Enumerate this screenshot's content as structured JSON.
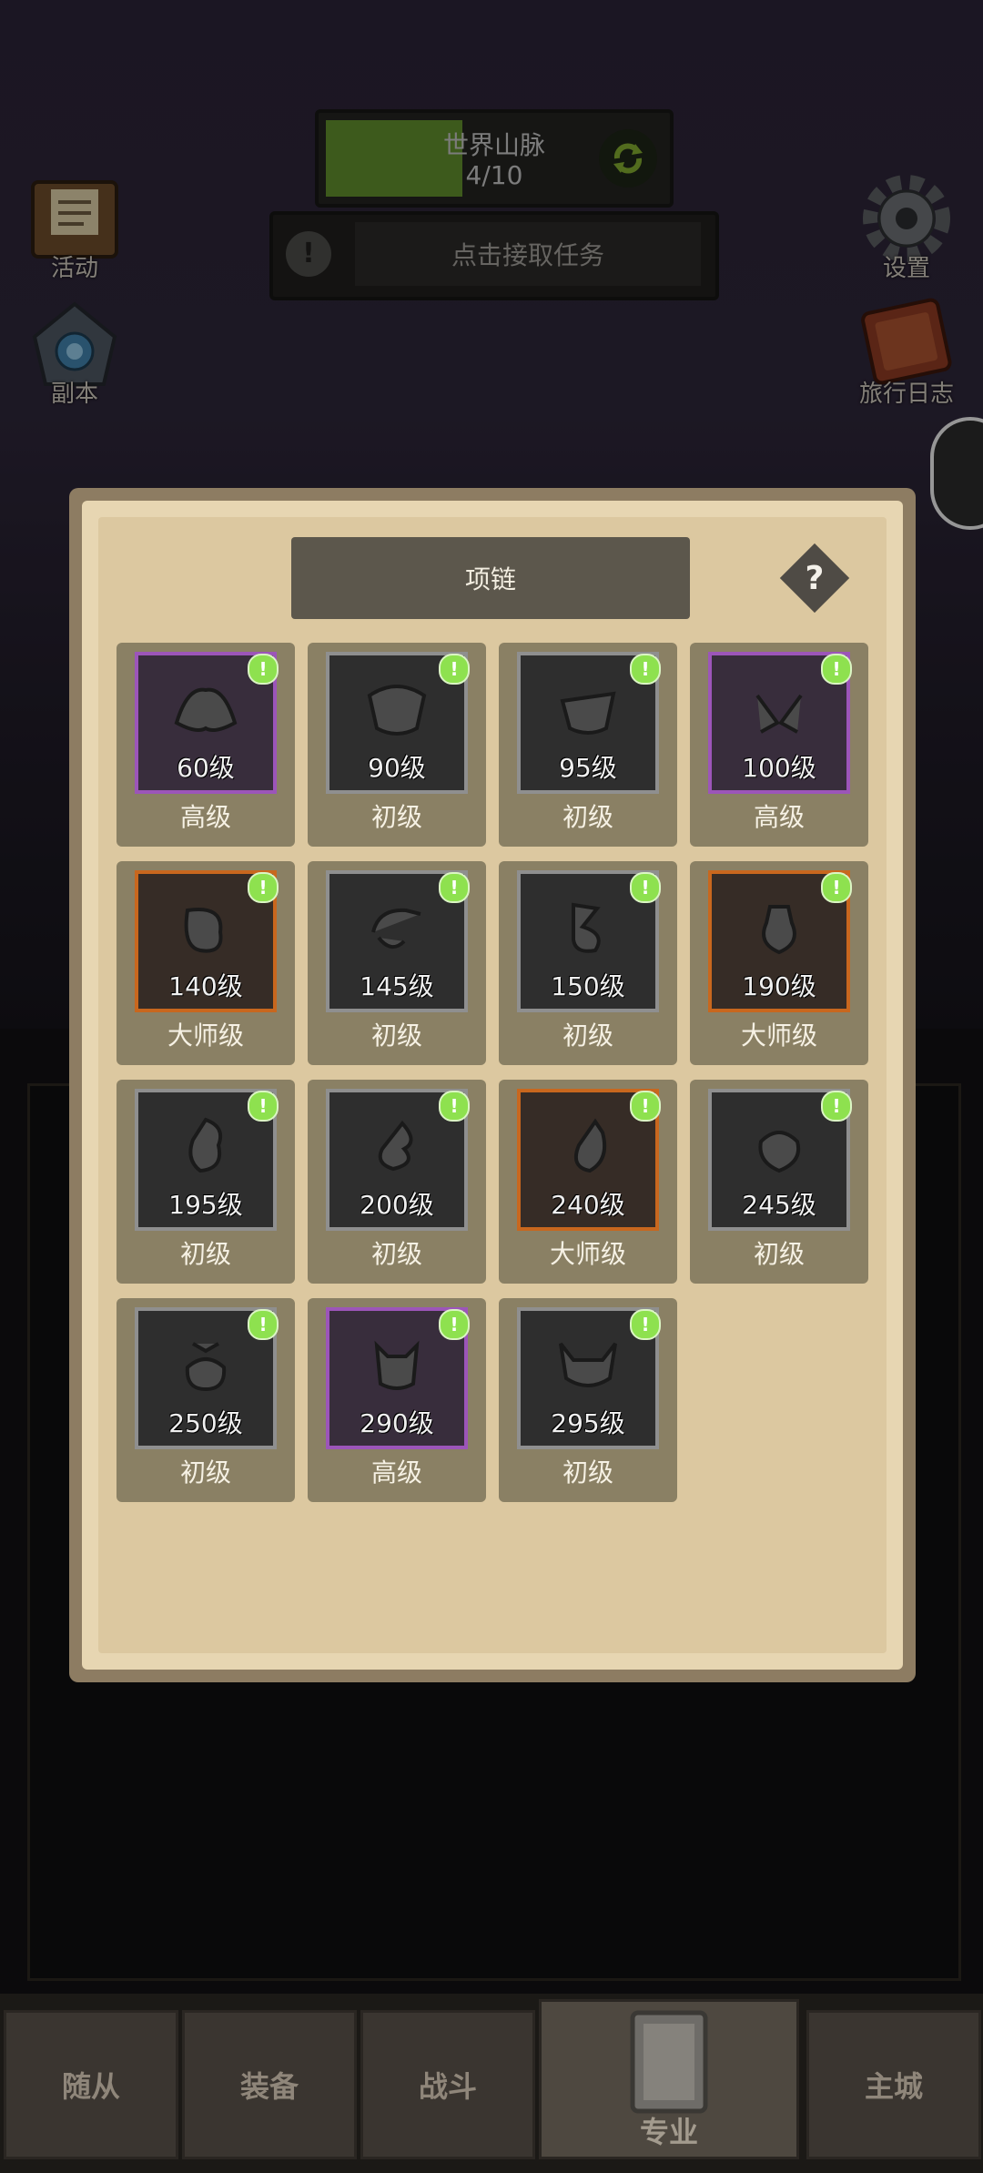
{
  "hud": {
    "map_title": "世界山脉",
    "map_progress": "4/10",
    "map_progress_fraction": 0.4,
    "quest_text": "点击接取任务"
  },
  "side_left": [
    {
      "label": "活动",
      "icon": "activity-board-icon"
    },
    {
      "label": "副本",
      "icon": "dungeon-portal-icon"
    }
  ],
  "side_right": [
    {
      "label": "设置",
      "icon": "gear-icon"
    },
    {
      "label": "旅行日志",
      "icon": "journal-book-icon"
    }
  ],
  "panel": {
    "title": "项链",
    "help_label": "?",
    "badge_symbol": "!",
    "items": [
      {
        "level": "60级",
        "grade": "高级",
        "quality": "senior"
      },
      {
        "level": "90级",
        "grade": "初级",
        "quality": "basic"
      },
      {
        "level": "95级",
        "grade": "初级",
        "quality": "basic"
      },
      {
        "level": "100级",
        "grade": "高级",
        "quality": "senior"
      },
      {
        "level": "140级",
        "grade": "大师级",
        "quality": "master"
      },
      {
        "level": "145级",
        "grade": "初级",
        "quality": "basic"
      },
      {
        "level": "150级",
        "grade": "初级",
        "quality": "basic"
      },
      {
        "level": "190级",
        "grade": "大师级",
        "quality": "master"
      },
      {
        "level": "195级",
        "grade": "初级",
        "quality": "basic"
      },
      {
        "level": "200级",
        "grade": "初级",
        "quality": "basic"
      },
      {
        "level": "240级",
        "grade": "大师级",
        "quality": "master"
      },
      {
        "level": "245级",
        "grade": "初级",
        "quality": "basic"
      },
      {
        "level": "250级",
        "grade": "初级",
        "quality": "basic"
      },
      {
        "level": "290级",
        "grade": "高级",
        "quality": "senior"
      },
      {
        "level": "295级",
        "grade": "初级",
        "quality": "basic"
      }
    ]
  },
  "nav": [
    {
      "label": "随从"
    },
    {
      "label": "装备"
    },
    {
      "label": "战斗"
    },
    {
      "label": "专业"
    },
    {
      "label": "主城"
    }
  ],
  "colors": {
    "quality_basic": "#8f8f8f",
    "quality_senior": "#9c55b9",
    "quality_master": "#c8671e",
    "badge_green": "#8ee14f"
  }
}
